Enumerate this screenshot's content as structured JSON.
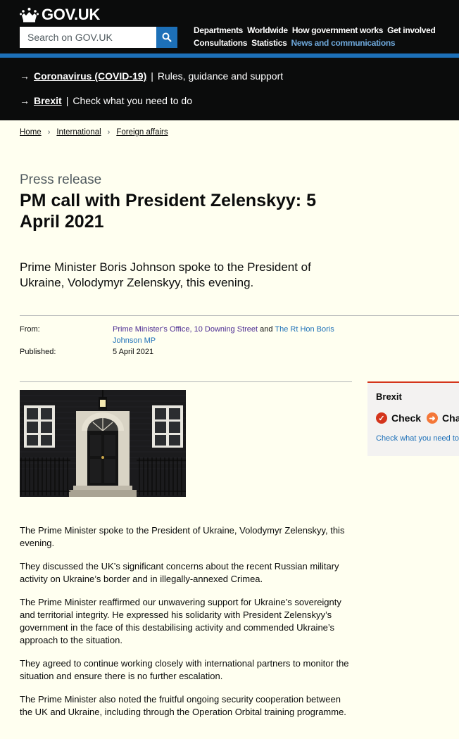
{
  "header": {
    "logo_text": "GOV.UK",
    "search_placeholder": "Search on GOV.UK",
    "nav_row1": [
      "Departments",
      "Worldwide",
      "How government works",
      "Get involved"
    ],
    "nav_row2": [
      "Consultations",
      "Statistics",
      "News and communications"
    ]
  },
  "banner": {
    "items": [
      {
        "link": "Coronavirus (COVID-19)",
        "text": "Rules, guidance and support"
      },
      {
        "link": "Brexit",
        "text": "Check what you need to do"
      }
    ]
  },
  "breadcrumb": [
    "Home",
    "International",
    "Foreign affairs"
  ],
  "page": {
    "caption": "Press release",
    "title": "PM call with President Zelenskyy: 5 April 2021",
    "lead": "Prime Minister Boris Johnson spoke to the President of Ukraine, Volodymyr Zelenskyy, this evening."
  },
  "meta": {
    "from_label": "From:",
    "from_link1": "Prime Minister's Office, 10 Downing Street",
    "from_and": "and",
    "from_link2": "The Rt Hon Boris Johnson MP",
    "published_label": "Published:",
    "published_value": "5 April 2021"
  },
  "sidebar": {
    "title": "Brexit",
    "item1": "Check",
    "item2": "Char",
    "link": "Check what you need to"
  },
  "body": [
    "The Prime Minister spoke to the President of Ukraine, Volodymyr Zelenskyy, this evening.",
    "They discussed the UK’s significant concerns about the recent Russian military activity on Ukraine’s border and in illegally-annexed Crimea.",
    "The Prime Minister reaffirmed our unwavering support for Ukraine’s sovereignty and territorial integrity. He expressed his solidarity with President Zelenskyy’s government in the face of this destabilising activity and commended Ukraine’s approach to the situation.",
    "They agreed to continue working closely with international partners to monitor the situation and ensure there is no further escalation.",
    "The Prime Minister also noted the fruitful ongoing security cooperation between the UK and Ukraine, including through the Operation Orbital training programme."
  ],
  "colors": {
    "header_bg": "#0b0c0c",
    "brand_blue": "#1d70b8",
    "page_bg": "#fffff0",
    "brexit_red": "#d4351c"
  }
}
